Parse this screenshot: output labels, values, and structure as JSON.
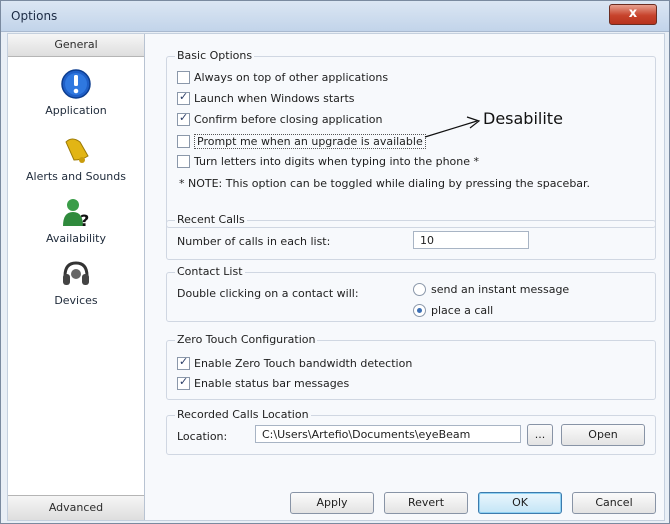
{
  "window": {
    "title": "Options",
    "close_glyph": "x"
  },
  "sidebar": {
    "header": "General",
    "footer": "Advanced",
    "items": [
      {
        "label": "Application",
        "icon": "info-icon"
      },
      {
        "label": "Alerts and Sounds",
        "icon": "bell-icon"
      },
      {
        "label": "Availability",
        "icon": "user-question-icon"
      },
      {
        "label": "Devices",
        "icon": "headset-icon"
      }
    ]
  },
  "basic": {
    "title": "Basic Options",
    "options": [
      {
        "label": "Always on top of other applications",
        "checked": false
      },
      {
        "label": "Launch when Windows starts",
        "checked": true
      },
      {
        "label": "Confirm before closing application",
        "checked": true
      },
      {
        "label": "Prompt me when an upgrade is available",
        "checked": false
      },
      {
        "label": "Turn letters into digits when typing into the phone *",
        "checked": false
      }
    ],
    "note": "* NOTE: This option can be toggled while dialing by pressing the spacebar."
  },
  "annotation": "Desabilite",
  "recent": {
    "title": "Recent Calls",
    "label": "Number of calls in each list:",
    "value": "10"
  },
  "contact": {
    "title": "Contact List",
    "label": "Double clicking on a contact will:",
    "options": [
      {
        "label": "send an instant message",
        "selected": false
      },
      {
        "label": "place a call",
        "selected": true
      }
    ]
  },
  "zero": {
    "title": "Zero Touch Configuration",
    "options": [
      {
        "label": "Enable Zero Touch bandwidth detection",
        "checked": true
      },
      {
        "label": "Enable status bar messages",
        "checked": true
      }
    ]
  },
  "recorded": {
    "title": "Recorded Calls Location",
    "label": "Location:",
    "value": "C:\\Users\\Artefio\\Documents\\eyeBeam",
    "browse": "...",
    "open": "Open"
  },
  "buttons": {
    "apply": "Apply",
    "revert": "Revert",
    "ok": "OK",
    "cancel": "Cancel"
  }
}
